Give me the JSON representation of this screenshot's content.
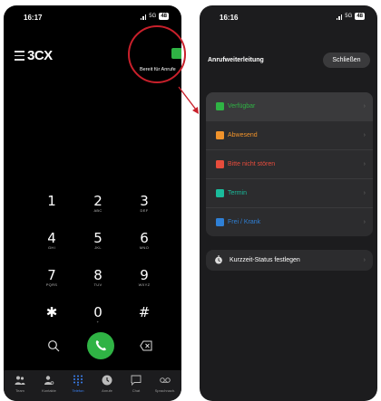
{
  "colors": {
    "presence_green": "#2fb344",
    "away_orange": "#f0932b",
    "dnd_red": "#e74c3c",
    "meeting_teal": "#1abc9c",
    "sick_blue": "#2f80d6",
    "accent_blue": "#3b82f6",
    "highlight_red": "#c8202b"
  },
  "left_phone": {
    "status_bar": {
      "time": "16:17",
      "network": "5G",
      "battery": "48"
    },
    "header": {
      "logo_part1": "3",
      "logo_part2": "CX",
      "menu_icon": "hamburger-icon"
    },
    "presence": {
      "status_text": "Bereit für Anrufe"
    },
    "keypad": [
      {
        "digit": "1",
        "letters": ""
      },
      {
        "digit": "2",
        "letters": "ABC"
      },
      {
        "digit": "3",
        "letters": "DEF"
      },
      {
        "digit": "4",
        "letters": "GHI"
      },
      {
        "digit": "5",
        "letters": "JKL"
      },
      {
        "digit": "6",
        "letters": "MNO"
      },
      {
        "digit": "7",
        "letters": "PQRS"
      },
      {
        "digit": "8",
        "letters": "TUV"
      },
      {
        "digit": "9",
        "letters": "WXYZ"
      },
      {
        "digit": "✱",
        "letters": ""
      },
      {
        "digit": "0",
        "letters": "+"
      },
      {
        "digit": "#",
        "letters": ""
      }
    ],
    "actions": {
      "search_icon": "search-icon",
      "call_icon": "phone-icon",
      "backspace_icon": "backspace-icon"
    },
    "tabs": [
      {
        "label": "Team",
        "icon": "team-icon"
      },
      {
        "label": "Kontakte",
        "icon": "contacts-icon"
      },
      {
        "label": "Telefon",
        "icon": "dialpad-icon"
      },
      {
        "label": "Anrufe",
        "icon": "clock-icon"
      },
      {
        "label": "Chat",
        "icon": "chat-icon"
      },
      {
        "label": "Sprachnach.",
        "icon": "voicemail-icon"
      }
    ],
    "active_tab": "Telefon"
  },
  "right_phone": {
    "status_bar": {
      "time": "16:16",
      "network": "5G",
      "battery": "48"
    },
    "title": "Anrufweiterleitung",
    "close_label": "Schließen",
    "statuses": [
      {
        "label": "Verfügbar",
        "color": "#2fb344",
        "selected": true
      },
      {
        "label": "Abwesend",
        "color": "#f0932b",
        "selected": false
      },
      {
        "label": "Bitte nicht stören",
        "color": "#e74c3c",
        "selected": false
      },
      {
        "label": "Termin",
        "color": "#1abc9c",
        "selected": false
      },
      {
        "label": "Frei / Krank",
        "color": "#2f80d6",
        "selected": false
      }
    ],
    "temporary_status": {
      "label": "Kurzzeit-Status festlegen",
      "icon": "timer-icon"
    }
  }
}
